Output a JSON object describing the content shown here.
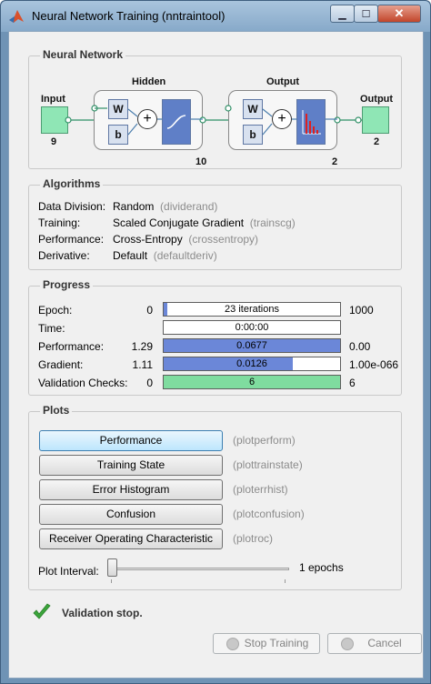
{
  "window": {
    "title": "Neural Network Training (nntraintool)",
    "minimize_glyph": "▁",
    "maximize_glyph": "☐",
    "close_glyph": "✕"
  },
  "neural_network": {
    "heading": "Neural Network",
    "input_label": "Input",
    "input_size": "9",
    "hidden_label": "Hidden",
    "hidden_size": "10",
    "output_layer_label": "Output",
    "output_layer_size": "2",
    "output_label": "Output",
    "output_size": "2",
    "weight_symbol": "W",
    "bias_symbol": "b",
    "sum_symbol": "+"
  },
  "algorithms": {
    "heading": "Algorithms",
    "rows": [
      {
        "label": "Data Division:",
        "value": "Random",
        "func": "(dividerand)"
      },
      {
        "label": "Training:",
        "value": "Scaled Conjugate Gradient",
        "func": "(trainscg)"
      },
      {
        "label": "Performance:",
        "value": "Cross-Entropy",
        "func": "(crossentropy)"
      },
      {
        "label": "Derivative:",
        "value": "Default",
        "func": "(defaultderiv)"
      }
    ]
  },
  "progress": {
    "heading": "Progress",
    "rows": [
      {
        "label": "Epoch:",
        "start": "0",
        "bar_text": "23 iterations",
        "end": "1000",
        "fill": 0.023,
        "color": "#6b87d8"
      },
      {
        "label": "Time:",
        "start": "",
        "bar_text": "0:00:00",
        "end": "",
        "fill": 0.0,
        "color": "#6b87d8"
      },
      {
        "label": "Performance:",
        "start": "1.29",
        "bar_text": "0.0677",
        "end": "0.00",
        "fill": 1.0,
        "color": "#6b87d8"
      },
      {
        "label": "Gradient:",
        "start": "1.11",
        "bar_text": "0.0126",
        "end": "1.00e-066",
        "fill": 0.73,
        "color": "#6b87d8"
      },
      {
        "label": "Validation Checks:",
        "start": "0",
        "bar_text": "6",
        "end": "6",
        "fill": 1.0,
        "color": "#7fdc9f"
      }
    ]
  },
  "plots": {
    "heading": "Plots",
    "buttons": [
      {
        "label": "Performance",
        "func": "(plotperform)"
      },
      {
        "label": "Training State",
        "func": "(plottrainstate)"
      },
      {
        "label": "Error Histogram",
        "func": "(ploterrhist)"
      },
      {
        "label": "Confusion",
        "func": "(plotconfusion)"
      },
      {
        "label": "Receiver Operating Characteristic",
        "func": "(plotroc)"
      }
    ],
    "interval_label": "Plot Interval:",
    "interval_value": "1 epochs",
    "interval_fraction": 0.0
  },
  "status": {
    "text": "Validation stop.",
    "check_color": "#3ba53b"
  },
  "actions": {
    "stop_label": "Stop Training",
    "cancel_label": "Cancel"
  }
}
